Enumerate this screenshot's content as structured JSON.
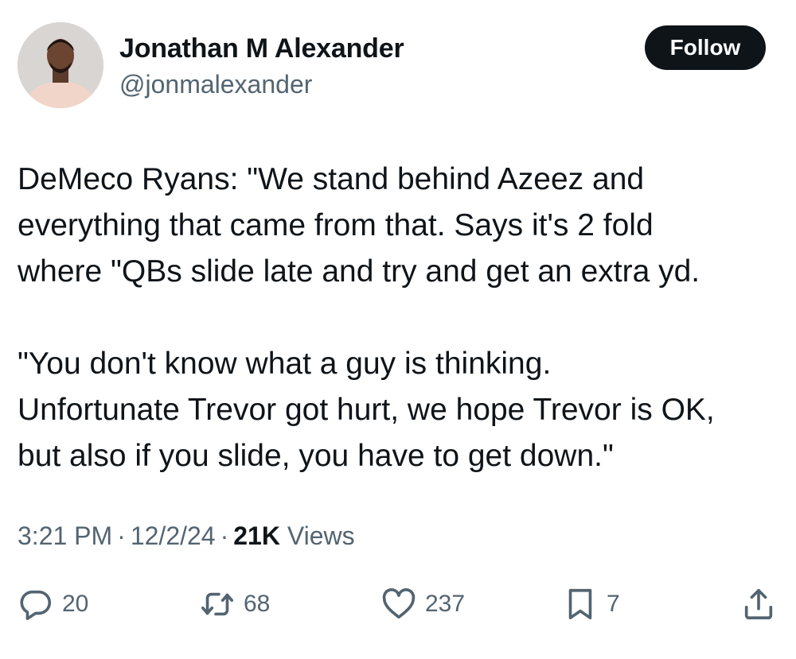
{
  "author": {
    "name": "Jonathan M Alexander",
    "handle": "@jonmalexander"
  },
  "follow_button": {
    "label": "Follow"
  },
  "tweet": {
    "paragraph1": [
      "DeMeco Ryans: \"We stand behind Azeez and",
      "everything that came from that. Says it's 2 fold",
      "where \"QBs slide late and try and get an extra yd."
    ],
    "paragraph2": [
      "\"You don't know what a guy is thinking.",
      "Unfortunate Trevor got hurt, we hope Trevor is OK,",
      "but also if you slide, you have to get down.\""
    ]
  },
  "meta": {
    "time": "3:21 PM",
    "separator": "·",
    "date": "12/2/24",
    "views_count": "21K",
    "views_label": "Views"
  },
  "actions": {
    "reply": {
      "count": "20",
      "icon": "reply-icon"
    },
    "retweet": {
      "count": "68",
      "icon": "retweet-icon"
    },
    "like": {
      "count": "237",
      "icon": "heart-icon"
    },
    "bookmark": {
      "count": "7",
      "icon": "bookmark-icon"
    },
    "share": {
      "icon": "share-icon"
    }
  },
  "colors": {
    "text_primary": "#0f1419",
    "text_secondary": "#536471",
    "button_bg": "#0f1419",
    "button_text": "#ffffff"
  }
}
